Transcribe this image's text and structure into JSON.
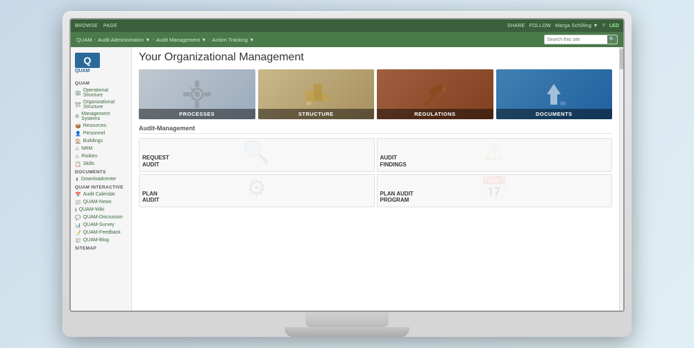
{
  "monitor": {
    "top_bar": {
      "left_items": [
        "BROWSE",
        "PAGE"
      ],
      "right_items": [
        "SHARE",
        "FOLLOW",
        "Marga Schilling ▼",
        "?"
      ],
      "led_label": "LED"
    },
    "nav": {
      "breadcrumbs": [
        "QUAM",
        "Audit Administration ▼",
        "Audit Management ▼",
        "Action Tracking ▼"
      ],
      "search_placeholder": "Search this site"
    },
    "sidebar": {
      "logo_text": "QUAM",
      "logo_subtext": "QUAM",
      "sections": [
        {
          "header": "QUAM",
          "items": [
            {
              "icon": "🏢",
              "label": "Operational Structure"
            },
            {
              "icon": "🏗",
              "label": "Organizational Structure"
            },
            {
              "icon": "⚙",
              "label": "Management Systems"
            },
            {
              "icon": "📦",
              "label": "Resources"
            },
            {
              "icon": "👤",
              "label": "Personnel"
            },
            {
              "icon": "🏠",
              "label": "Buildings"
            },
            {
              "icon": "⚠",
              "label": "NRM"
            },
            {
              "icon": "⚠",
              "label": "Risiken"
            },
            {
              "icon": "📋",
              "label": "Skills"
            }
          ]
        },
        {
          "header": "DOCUMENTS",
          "items": [
            {
              "icon": "⬇",
              "label": "Downloadcenter"
            }
          ]
        },
        {
          "header": "QUAM INTERACTIVE",
          "items": [
            {
              "icon": "📅",
              "label": "Audit Calendar"
            },
            {
              "icon": "📰",
              "label": "QUAM-News"
            },
            {
              "icon": "ℹ",
              "label": "QUAM-Wiki"
            },
            {
              "icon": "💬",
              "label": "QUAM-Discussion"
            },
            {
              "icon": "📊",
              "label": "QUAM-Survey"
            },
            {
              "icon": "📝",
              "label": "QUAM-Feedback"
            },
            {
              "icon": "📰",
              "label": "QUAM-Blog"
            }
          ]
        },
        {
          "header": "SITEMAP",
          "items": []
        }
      ]
    },
    "content": {
      "page_title": "Your Organizational Management",
      "tiles": [
        {
          "label": "PROCESSES",
          "theme": "processes"
        },
        {
          "label": "STRUCTURE",
          "theme": "structure"
        },
        {
          "label": "REGULATIONS",
          "theme": "regulations"
        },
        {
          "label": "DOCUMENTS",
          "theme": "documents"
        }
      ],
      "audit_section": {
        "title": "Audit-Management",
        "items": [
          {
            "label": "REQUEST\nAUDIT",
            "icon": "🔍"
          },
          {
            "label": "AUDIT\nFINDINGS",
            "icon": "⚠"
          },
          {
            "label": "PLAN\nAUDIT",
            "icon": "⚙"
          },
          {
            "label": "PLAN AUDIT\nPROGRAM",
            "icon": "📅"
          }
        ]
      }
    }
  }
}
